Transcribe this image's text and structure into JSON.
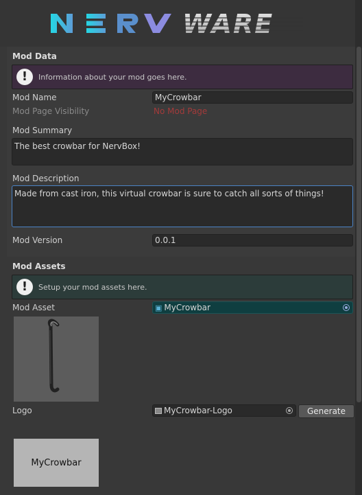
{
  "header": {
    "logo_text": "NERVWARE"
  },
  "mod_data": {
    "title": "Mod Data",
    "info": "Information about your mod goes here.",
    "name_label": "Mod Name",
    "name_value": "MyCrowbar",
    "visibility_label": "Mod Page Visibility",
    "visibility_value": "No Mod Page",
    "summary_label": "Mod Summary",
    "summary_value": "The best crowbar for NervBox!",
    "description_label": "Mod Description",
    "description_value": "Made from cast iron, this virtual crowbar is sure to catch all sorts of things!",
    "version_label": "Mod Version",
    "version_value": "0.0.1"
  },
  "mod_assets": {
    "title": "Mod Assets",
    "info": "Setup your mod assets here.",
    "asset_label": "Mod Asset",
    "asset_value": "MyCrowbar",
    "logo_label": "Logo",
    "logo_value": "MyCrowbar-Logo",
    "generate_label": "Generate",
    "logo_preview_text": "MyCrowbar"
  },
  "colors": {
    "accent_cyan": "#2ad3e0",
    "info_purple": "#3d2c40",
    "info_green": "#2c3c3a",
    "warning_red": "#a33a3a"
  },
  "icons": [
    "info-icon",
    "cube-icon",
    "object-picker-icon",
    "texture-icon"
  ]
}
